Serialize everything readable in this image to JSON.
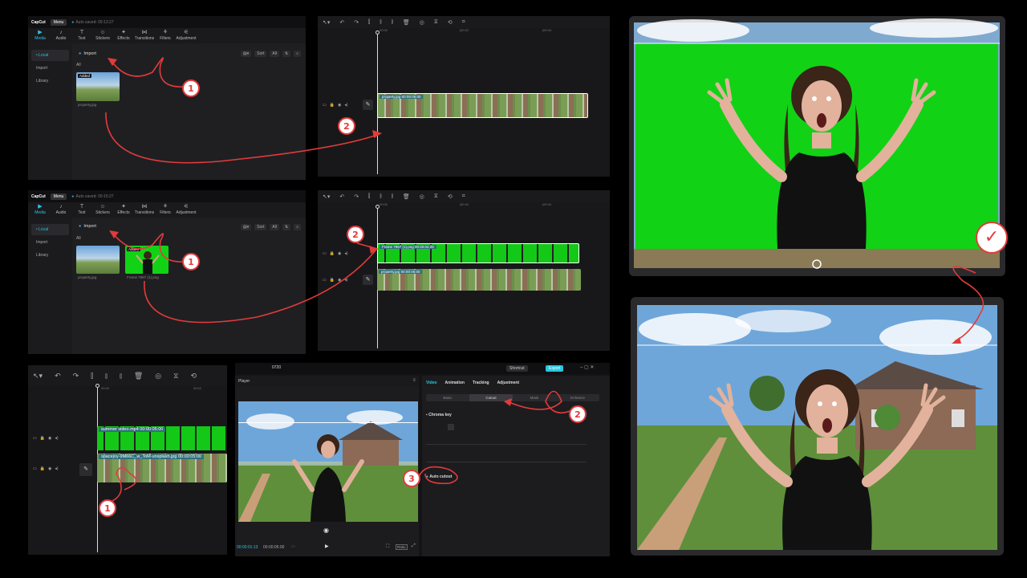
{
  "app": {
    "logo": "CapCut",
    "menu": "Menu",
    "autosave_1": "Auto saved: 09:13:27",
    "autosave_2": "Auto saved: 09:15:27"
  },
  "toolbar": {
    "items": [
      {
        "label": "Media",
        "icon": "media-icon"
      },
      {
        "label": "Audio",
        "icon": "audio-icon"
      },
      {
        "label": "Text",
        "icon": "text-icon"
      },
      {
        "label": "Stickers",
        "icon": "stickers-icon"
      },
      {
        "label": "Effects",
        "icon": "effects-icon"
      },
      {
        "label": "Transitions",
        "icon": "transitions-icon"
      },
      {
        "label": "Filters",
        "icon": "filters-icon"
      },
      {
        "label": "Adjustment",
        "icon": "adjustment-icon"
      }
    ]
  },
  "sidebar": {
    "items": [
      "• Local",
      "Import",
      "Library"
    ]
  },
  "media": {
    "import_label": "Import",
    "all_label": "All",
    "sort": "Sort",
    "all_btn": "All",
    "added": "Added",
    "file1": "property.jpg",
    "file2": "Frame 7967 (1).png"
  },
  "timeline1": {
    "ruler": [
      "00:00",
      "|00:02",
      "|00:04"
    ],
    "clip": "property.jpg   00:00:05:00"
  },
  "timeline2": {
    "ruler": [
      "00:00",
      "|00:02",
      "|00:04"
    ],
    "clip_top": "Frame 7967 (1).png   00:00:04:28",
    "clip_bottom": "property.jpg   00:00:05:00"
  },
  "timeline3": {
    "ruler": [
      "00:00",
      "00:02"
    ],
    "clip_top": "summer video.mp4   00:00:05:00",
    "clip_bottom": "spacejoy-9M66C_w_ToM-unsplash.jpg   00:00:05:00"
  },
  "editor": {
    "title": "0720",
    "shortcut": "Shortcut",
    "export": "Export",
    "player": "Player",
    "time_current": "00:00:01:13",
    "time_total": "00:00:05:00",
    "ratio": "Ratio",
    "tabs": [
      "Video",
      "Animation",
      "Tracking",
      "Adjustment"
    ],
    "subtabs": [
      "Basic",
      "Cutout",
      "Mask",
      "Enhance"
    ],
    "chroma_key": "Chroma key",
    "auto_cutout": "Auto cutout"
  },
  "badges": {
    "one": "1",
    "two": "2",
    "three": "3",
    "check": "✓"
  },
  "colors": {
    "accent": "#28c7e0",
    "annotation": "#e23b3b",
    "chroma_green": "#12d216"
  }
}
